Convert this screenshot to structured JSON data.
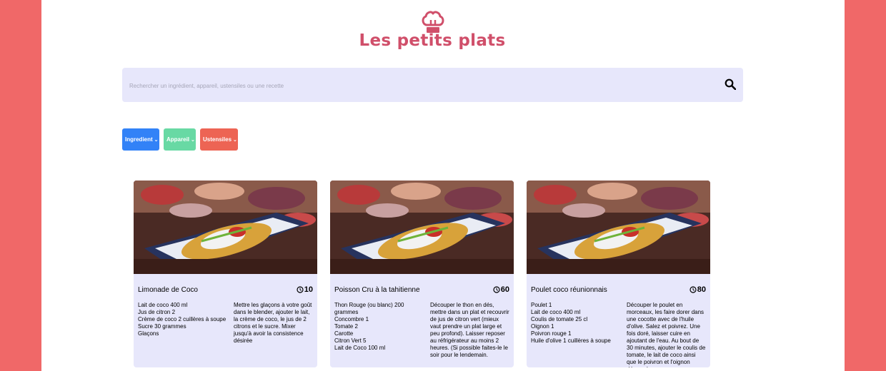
{
  "header": {
    "title": "Les petits plats",
    "logo_icon": "chef-hat-icon"
  },
  "search": {
    "placeholder": "Rechercher un ingrédient, appareil, ustensiles ou une recette",
    "icon": "search-icon"
  },
  "filters": [
    {
      "label": "Ingredient",
      "color": "#3282f7"
    },
    {
      "label": "Appareil",
      "color": "#68d9a4"
    },
    {
      "label": "Ustensiles",
      "color": "#ed6454"
    }
  ],
  "colors": {
    "accent": "#d04f6a",
    "background": "#f06868",
    "card": "#e7e7fb"
  },
  "recipes": [
    {
      "name": "Limonade de Coco",
      "time": "10",
      "ingredients": [
        "Lait de coco 400 ml",
        "Jus de citron 2",
        "Crème de coco 2 cuillères à soupe",
        "Sucre 30 grammes",
        "Glaçons"
      ],
      "description": "Mettre les glaçons à votre goût dans le blender, ajouter le lait, la crème de coco, le jus de 2 citrons et le sucre. Mixer jusqu'à avoir la consistence désirée"
    },
    {
      "name": "Poisson Cru à la tahitienne",
      "time": "60",
      "ingredients": [
        "Thon Rouge (ou blanc) 200 grammes",
        "Concombre 1",
        "Tomate 2",
        "Carotte",
        "Citron Vert 5",
        "Lait de Coco 100 ml"
      ],
      "description": "Découper le thon en dés, mettre dans un plat et recouvrir de jus de citron vert (mieux vaut prendre un plat large et peu profond). Laisser reposer au réfrigérateur au moins 2 heures. (Si possible faites-le le soir pour le lendemain."
    },
    {
      "name": "Poulet coco réunionnais",
      "time": "80",
      "ingredients": [
        "Poulet 1",
        "Lait de coco 400 ml",
        "Coulis de tomate 25 cl",
        "Oignon 1",
        "Poivron rouge 1",
        "Huile d'olive 1 cuillères à soupe"
      ],
      "description": "Découper le poulet en morceaux, les faire dorer dans une cocotte avec de l'huile d'olive. Salez et poivrez. Une fois doré, laisser cuire en ajoutant de l'eau. Au bout de 30 minutes, ajouter le coulis de tomate, le lait de coco ainsi que le poivron et l'oignon découpés."
    }
  ]
}
